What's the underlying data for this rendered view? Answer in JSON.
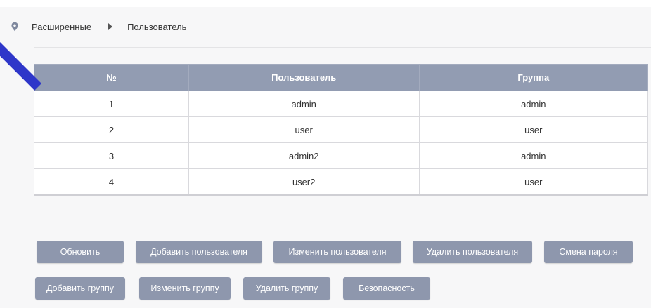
{
  "breadcrumb": {
    "parent": "Расширенные",
    "current": "Пользователь"
  },
  "table": {
    "headers": [
      "№",
      "Пользователь",
      "Группа"
    ],
    "rows": [
      {
        "num": "1",
        "user": "admin",
        "group": "admin"
      },
      {
        "num": "2",
        "user": "user",
        "group": "user"
      },
      {
        "num": "3",
        "user": "admin2",
        "group": "admin"
      },
      {
        "num": "4",
        "user": "user2",
        "group": "user"
      }
    ]
  },
  "buttons": {
    "refresh": "Обновить",
    "add_user": "Добавить пользователя",
    "edit_user": "Изменить пользователя",
    "delete_user": "Удалить пользователя",
    "change_password": "Смена пароля",
    "add_group": "Добавить группу",
    "edit_group": "Изменить группу",
    "delete_group": "Удалить группу",
    "security": "Безопасность"
  },
  "colors": {
    "header_bg": "#929cb2",
    "button_bg": "#8e97ad",
    "accent_stripe": "#2e36c9"
  },
  "icons": {
    "breadcrumb_pin": "map-pin-icon",
    "breadcrumb_separator": "caret-right-icon"
  }
}
